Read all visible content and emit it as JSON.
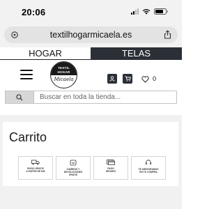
{
  "status_bar": {
    "time": "20:06"
  },
  "browser": {
    "url": "textilhogarmicaela.es"
  },
  "tabs": [
    {
      "label": "HOGAR",
      "active": true
    },
    {
      "label": "TELAS",
      "active": false
    }
  ],
  "header": {
    "logo": {
      "line1": "TEXTIL",
      "line2": "HOGAR",
      "script": "Micaela"
    },
    "wishlist_count": "0"
  },
  "search": {
    "placeholder": "Buscar en toda la tienda..."
  },
  "cart": {
    "title": "Carrito",
    "features": [
      {
        "icon": "truck-icon",
        "text": "ENVIO GRATIS\nA PARTIR DE 60€"
      },
      {
        "icon": "return-box-icon",
        "text": "CAMBIOS Y\nDEVOLUCIONES\nGRATIS"
      },
      {
        "icon": "payment-icon",
        "text": "PAGO\nSEGURO"
      },
      {
        "icon": "support-icon",
        "text": "TE ASESORAMOS\nEN TU COMPRA"
      }
    ]
  },
  "colors": {
    "dark": "#2b3037",
    "background_gray": "#f1f1f1"
  }
}
